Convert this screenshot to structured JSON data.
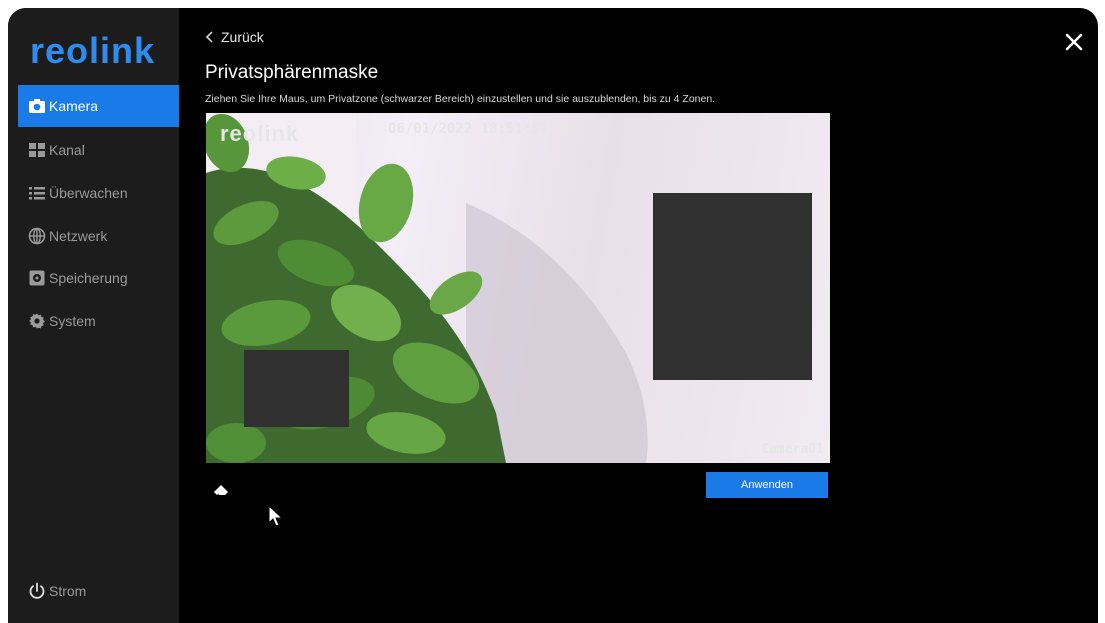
{
  "sidebar": {
    "logo": "reolink",
    "items": [
      {
        "label": "Kamera",
        "icon": "camera-icon",
        "active": true
      },
      {
        "label": "Kanal",
        "icon": "grid-icon",
        "active": false
      },
      {
        "label": "Überwachen",
        "icon": "list-icon",
        "active": false
      },
      {
        "label": "Netzwerk",
        "icon": "globe-icon",
        "active": false
      },
      {
        "label": "Speicherung",
        "icon": "storage-icon",
        "active": false
      },
      {
        "label": "System",
        "icon": "gear-icon",
        "active": false
      }
    ],
    "power": {
      "label": "Strom",
      "icon": "power-icon"
    }
  },
  "header": {
    "back_label": "Zurück",
    "title": "Privatsphärenmaske",
    "description": "Ziehen Sie Ihre Maus, um Privatzone (schwarzer Bereich) einzustellen und sie auszublenden, bis zu 4 Zonen."
  },
  "video": {
    "osd_logo": "reolink",
    "osd_timestamp": "06/01/2022 18:51:51 THU",
    "osd_camera": "Camera01",
    "mask_count": 2
  },
  "toolbar": {
    "eraser_icon": "eraser-icon",
    "apply_label": "Anwenden"
  },
  "colors": {
    "accent": "#1a7ae8",
    "sidebar_bg": "#1c1c1c",
    "mask": "#303030"
  }
}
